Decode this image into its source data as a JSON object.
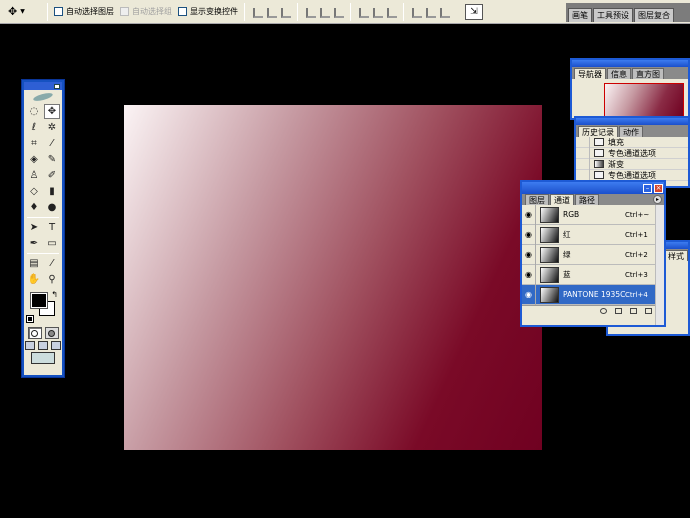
{
  "options_bar": {
    "auto_select_layer": "自动选择图层",
    "auto_select_group": "自动选择组",
    "show_transform_controls": "显示变换控件"
  },
  "palette_well": {
    "tabs": [
      "画笔",
      "工具预设",
      "图层复合"
    ]
  },
  "navigator_panel": {
    "tabs": [
      "导航器",
      "信息",
      "直方图"
    ]
  },
  "history_panel": {
    "tabs": [
      "历史记录",
      "动作"
    ],
    "items": [
      "填充",
      "专色通道选项",
      "渐变",
      "专色通道选项"
    ]
  },
  "channels_panel": {
    "tabs": [
      "图层",
      "通道",
      "路径"
    ],
    "channels": [
      {
        "name": "RGB",
        "shortcut": "Ctrl+~"
      },
      {
        "name": "红",
        "shortcut": "Ctrl+1"
      },
      {
        "name": "绿",
        "shortcut": "Ctrl+2"
      },
      {
        "name": "蓝",
        "shortcut": "Ctrl+3"
      },
      {
        "name": "PANTONE 1935C",
        "shortcut": "Ctrl+4"
      }
    ]
  },
  "styles_panel": {
    "tab": "样式"
  },
  "colors": {
    "foreground": "#000000",
    "background": "#ffffff",
    "gradient_end": "#700121"
  }
}
